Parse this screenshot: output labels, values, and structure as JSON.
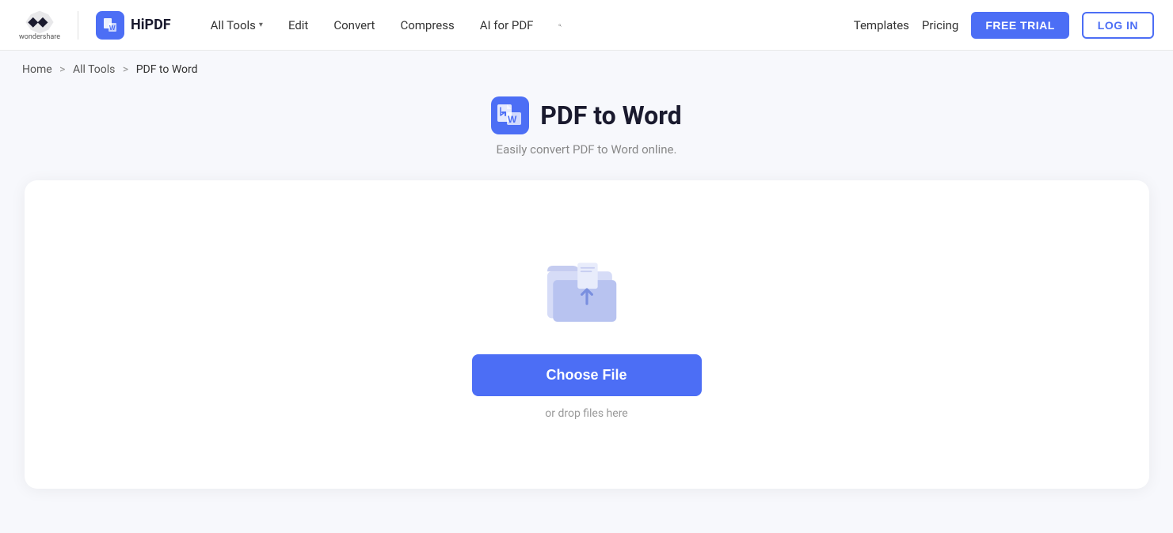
{
  "header": {
    "wondershare_alt": "Wondershare",
    "hipdf_label": "HiPDF",
    "nav": {
      "all_tools": "All Tools",
      "edit": "Edit",
      "convert": "Convert",
      "compress": "Compress",
      "ai_for_pdf": "AI for PDF"
    },
    "right_nav": {
      "templates": "Templates",
      "pricing": "Pricing"
    },
    "free_trial": "FREE TRIAL",
    "login": "LOG IN"
  },
  "breadcrumb": {
    "home": "Home",
    "all_tools": "All Tools",
    "current": "PDF to Word"
  },
  "page": {
    "title": "PDF to Word",
    "subtitle": "Easily convert PDF to Word online.",
    "choose_file": "Choose File",
    "drop_hint": "or drop files here"
  }
}
